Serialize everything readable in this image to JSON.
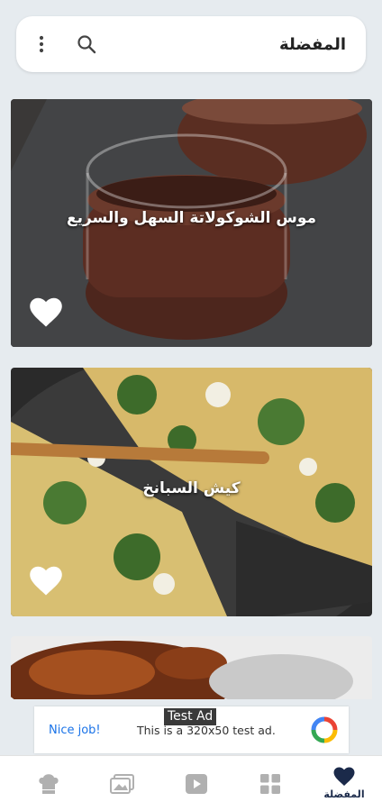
{
  "header": {
    "title": "المفضلة",
    "icons": [
      "more-vert-icon",
      "search-icon"
    ]
  },
  "recipes": [
    {
      "title": "موس الشوكولاتة السهل والسريع",
      "favorite": true
    },
    {
      "title": "كيش السبانخ",
      "favorite": true
    },
    {
      "title": "",
      "favorite": true
    }
  ],
  "ad": {
    "label": "Test Ad",
    "cta": "Nice job!",
    "text": "This is a 320x50 test ad."
  },
  "bottom_nav": {
    "items": [
      {
        "icon": "chef-hat-icon",
        "label": ""
      },
      {
        "icon": "gallery-icon",
        "label": ""
      },
      {
        "icon": "video-icon",
        "label": ""
      },
      {
        "icon": "grid-icon",
        "label": ""
      },
      {
        "icon": "heart-icon",
        "label": "المفضلة",
        "active": true
      }
    ]
  },
  "colors": {
    "background": "#e6ebef",
    "accent": "#1b2a4a",
    "ad_link": "#1a73e8",
    "inactive_icon": "#b0b0b0"
  }
}
